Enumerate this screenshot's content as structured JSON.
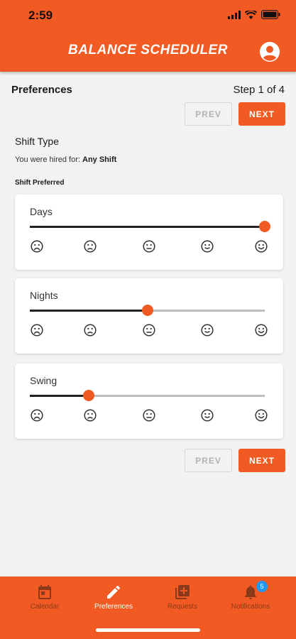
{
  "status_bar": {
    "time": "2:59"
  },
  "header": {
    "title": "BALANCE SCHEDULER",
    "account_icon": "account-circle-icon"
  },
  "page": {
    "title": "Preferences",
    "step": "Step 1 of 4"
  },
  "nav_buttons": {
    "prev_label": "PREV",
    "next_label": "NEXT"
  },
  "section": {
    "title": "Shift Type",
    "hired_prefix": "You were hired for:",
    "hired_value": "Any Shift",
    "preferred_label": "Shift Preferred"
  },
  "shifts": [
    {
      "label": "Days",
      "value_fraction": 1.0
    },
    {
      "label": "Nights",
      "value_fraction": 0.5
    },
    {
      "label": "Swing",
      "value_fraction": 0.25
    }
  ],
  "scale_icons": [
    "very-dissatisfied-icon",
    "dissatisfied-icon",
    "neutral-icon",
    "satisfied-icon",
    "very-satisfied-icon"
  ],
  "tabs": [
    {
      "label": "Calendar",
      "icon": "calendar-icon",
      "active": false
    },
    {
      "label": "Preferences",
      "icon": "edit-pencil-icon",
      "active": true
    },
    {
      "label": "Requests",
      "icon": "add-box-icon",
      "active": false
    },
    {
      "label": "Notifications",
      "icon": "bell-icon",
      "active": false,
      "badge": "5"
    }
  ],
  "colors": {
    "brand": "#f15a22",
    "badge": "#2196f3",
    "background": "#f2f2f2"
  }
}
